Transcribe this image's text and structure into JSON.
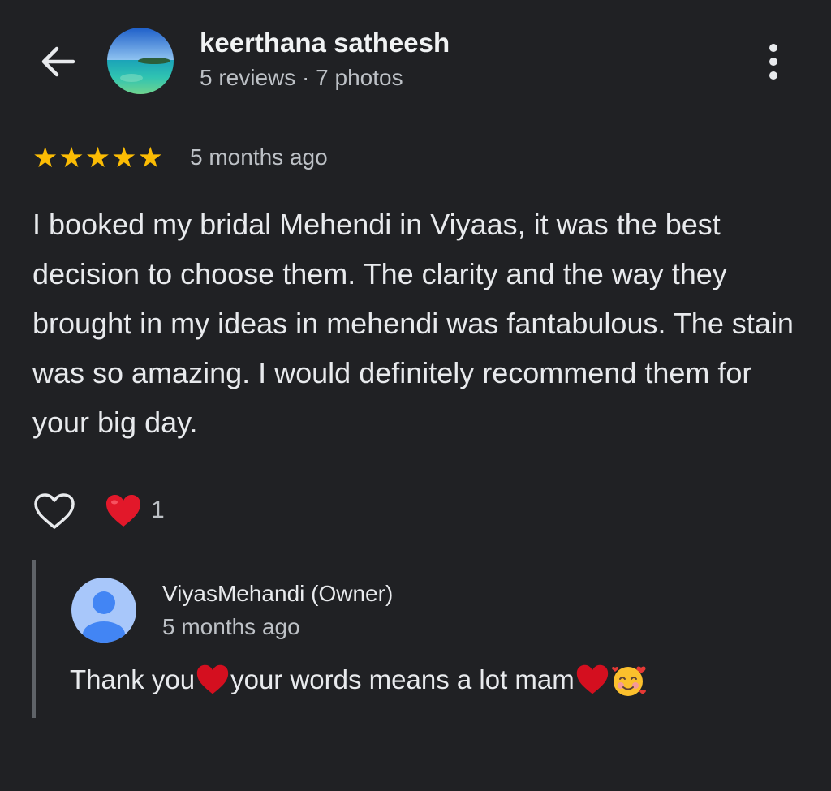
{
  "header": {
    "reviewer_name": "keerthana satheesh",
    "reviewer_meta": "5 reviews · 7 photos",
    "back_icon": "arrow-left-icon",
    "menu_icon": "more-vert-icon"
  },
  "review": {
    "rating": 5,
    "max_rating": 5,
    "star_glyph": "★",
    "star_color": "#fbbc04",
    "time": "5 months ago",
    "text": "I booked my bridal Mehendi in Viyaas, it was the best decision to choose them. The clarity and the way they brought in my ideas in mehendi was fantabulous. The stain was so amazing. I would definitely recommend them for your big day."
  },
  "reactions": {
    "like_icon": "heart-outline-icon",
    "reaction_icon": "red-heart-icon",
    "count": "1"
  },
  "owner_reply": {
    "name": "ViyasMehandi (Owner)",
    "time": "5 months ago",
    "text_part1": "Thank you",
    "text_part2": " your words means a lot mam",
    "emojis": [
      "red-heart-icon",
      "red-heart-icon",
      "smiling-face-with-hearts-icon"
    ]
  },
  "colors": {
    "background": "#202124",
    "text_primary": "#e8eaed",
    "text_secondary": "#bdc1c6",
    "divider": "#5f6368"
  }
}
